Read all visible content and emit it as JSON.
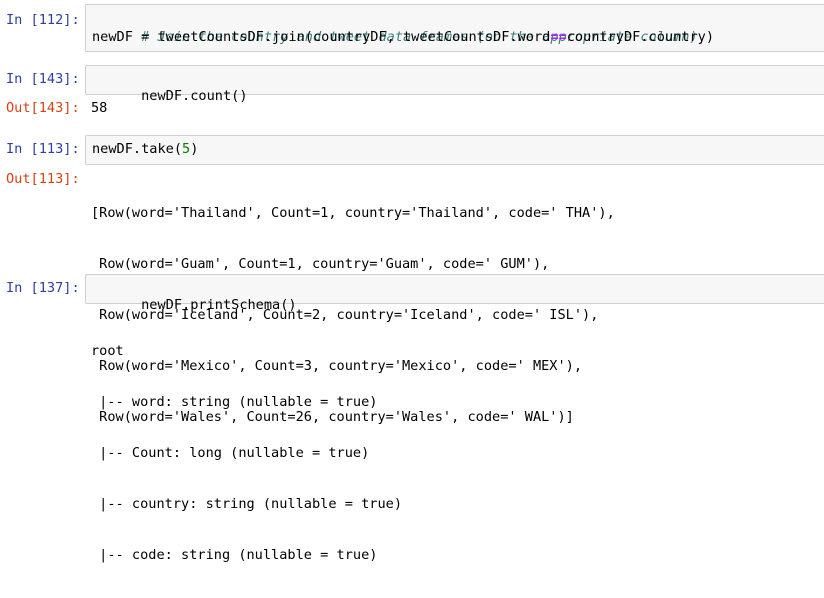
{
  "cells": {
    "c112": {
      "prompt": "In [112]:",
      "comment": "# Join the country and tweet data frames (on the appropriate column)",
      "code_a": "newDF = tweetCountsDF.join(countryDF, tweetCountsDF.word",
      "code_op": "==",
      "code_b": "countryDF.country)"
    },
    "c143": {
      "prompt": "In [143]:",
      "code": "newDF.count()",
      "out_prompt": "Out[143]:",
      "output": "58"
    },
    "c113": {
      "prompt": "In [113]:",
      "code_a": "newDF.take(",
      "code_num": "5",
      "code_b": ")",
      "out_prompt": "Out[113]:",
      "output_lines": [
        "[Row(word='Thailand', Count=1, country='Thailand', code=' THA'),",
        " Row(word='Guam', Count=1, country='Guam', code=' GUM'),",
        " Row(word='Iceland', Count=2, country='Iceland', code=' ISL'),",
        " Row(word='Mexico', Count=3, country='Mexico', code=' MEX'),",
        " Row(word='Wales', Count=26, country='Wales', code=' WAL')]"
      ]
    },
    "c137": {
      "prompt": "In [137]:",
      "code": "newDF.printSchema()",
      "output_lines": [
        "root",
        " |-- word: string (nullable = true)",
        " |-- Count: long (nullable = true)",
        " |-- country: string (nullable = true)",
        " |-- code: string (nullable = true)"
      ]
    }
  },
  "colors": {
    "in_prompt": "#303f9f",
    "out_prompt": "#d84315",
    "comment": "#408080",
    "operator": "#aa22ff",
    "number": "#008000",
    "input_bg": "#f7f7f7",
    "input_border": "#cfcfcf"
  }
}
